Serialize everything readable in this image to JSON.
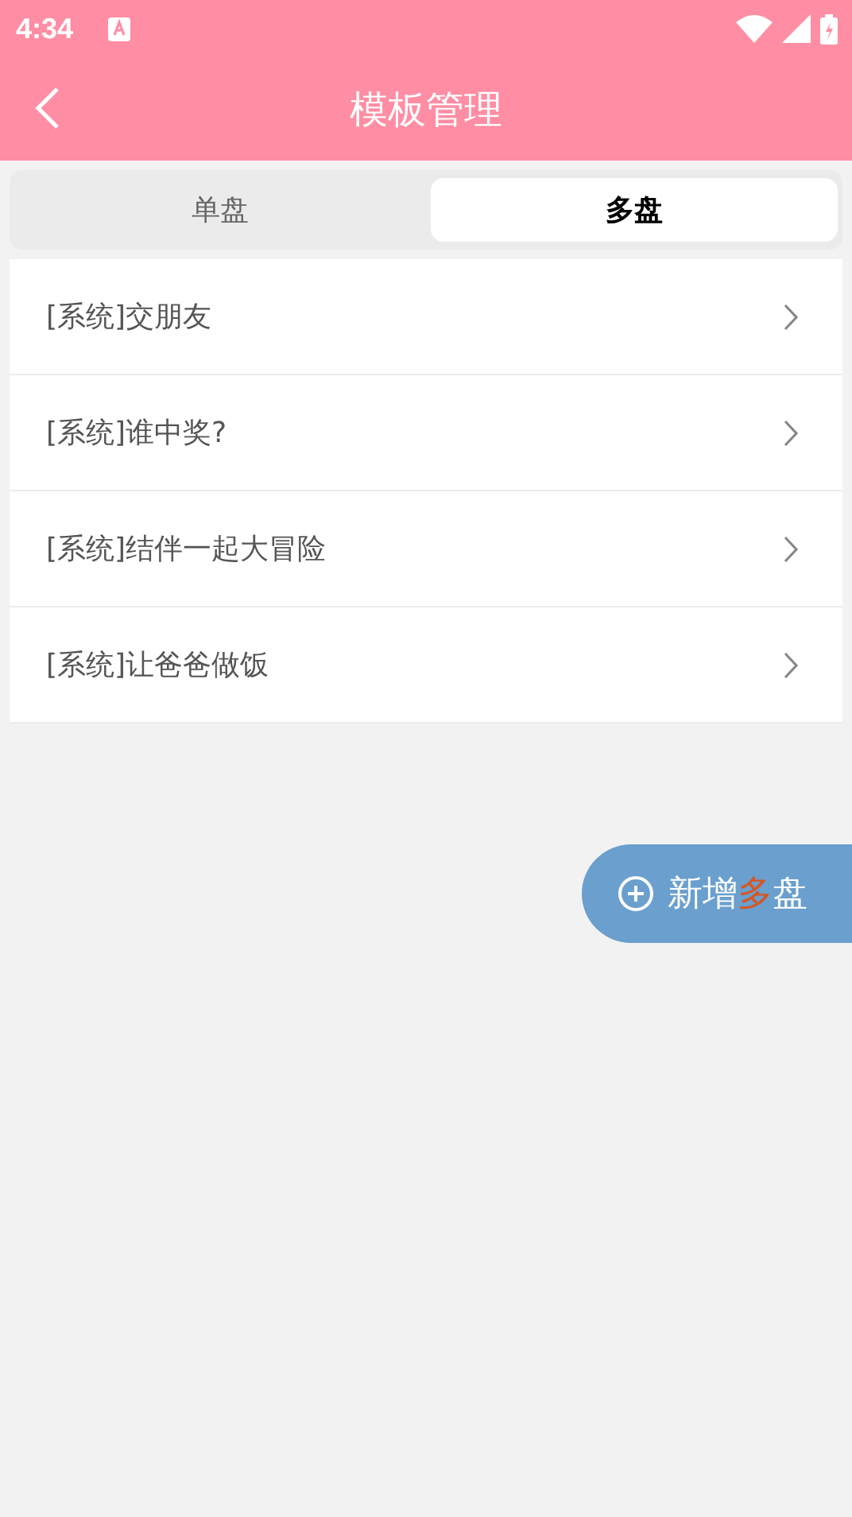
{
  "status_bar": {
    "time": "4:34"
  },
  "header": {
    "title": "模板管理"
  },
  "tabs": [
    {
      "label": "单盘",
      "selected": false
    },
    {
      "label": "多盘",
      "selected": true
    }
  ],
  "templates": [
    {
      "name": "[系统]交朋友"
    },
    {
      "name": "[系统]谁中奖?"
    },
    {
      "name": "[系统]结伴一起大冒险"
    },
    {
      "name": "[系统]让爸爸做饭"
    }
  ],
  "add_button": {
    "parts": [
      {
        "text": "新增",
        "highlight": false
      },
      {
        "text": "多",
        "highlight": true
      },
      {
        "text": "盘",
        "highlight": false
      }
    ]
  }
}
